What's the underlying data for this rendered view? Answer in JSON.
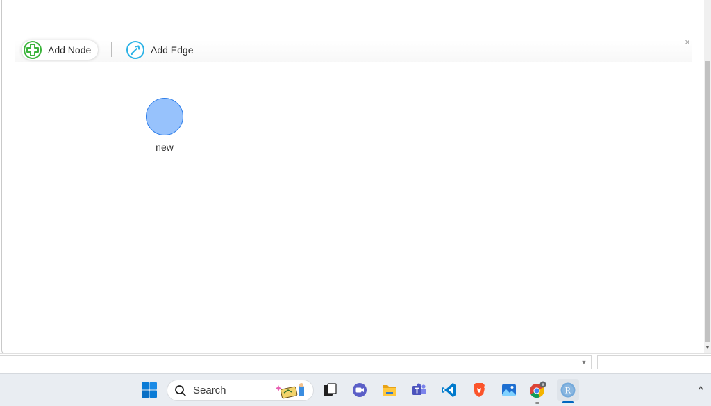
{
  "toolbar": {
    "add_node_label": "Add Node",
    "add_edge_label": "Add Edge",
    "close_symbol": "×"
  },
  "network": {
    "nodes": [
      {
        "label": "new",
        "color": "#97c2fc",
        "border": "#2b7ce9"
      }
    ]
  },
  "taskbar": {
    "search_label": "Search",
    "apps": [
      "windows-start-icon",
      "search-icon",
      "task-view-icon",
      "meet-icon",
      "file-explorer-icon",
      "teams-icon",
      "vscode-icon",
      "brave-icon",
      "photos-icon",
      "chrome-icon",
      "r-icon"
    ],
    "chrome_badge": "a",
    "r_letter": "R"
  },
  "colors": {
    "accent": "#0067c0",
    "add_node_icon": "#3cb43c",
    "add_edge_icon": "#2bb2e6"
  }
}
